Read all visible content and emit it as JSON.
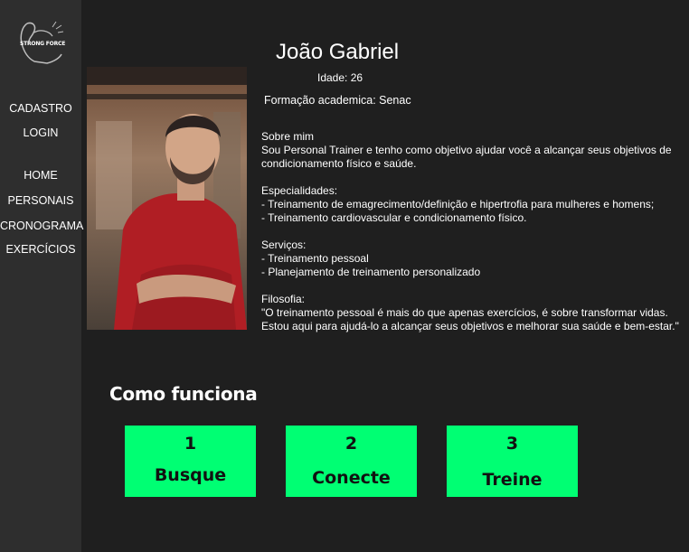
{
  "brand": {
    "logo_text": "STRONG FORCE"
  },
  "sidebar": {
    "auth": [
      {
        "label": "CADASTRO"
      },
      {
        "label": "LOGIN"
      }
    ],
    "nav": [
      {
        "label": "HOME"
      },
      {
        "label": "PERSONAIS"
      },
      {
        "label": "CRONOGRAMA"
      },
      {
        "label": "EXERCÍCIOS"
      }
    ]
  },
  "profile": {
    "name": "João Gabriel",
    "age": "Idade: 26",
    "formacao": "Formação academica: Senac",
    "sections": [
      {
        "text": "Sobre mim\nSou Personal Trainer e tenho como objetivo ajudar você a alcançar seus objetivos de condicionamento físico e saúde."
      },
      {
        "text": "Especialidades:\n- Treinamento de emagrecimento/definição e hipertrofia para mulheres e homens;\n- Treinamento cardiovascular e condicionamento físico."
      },
      {
        "text": "Serviços:\n- Treinamento pessoal\n- Planejamento de treinamento personalizado"
      },
      {
        "text": "Filosofia:\n\"O treinamento pessoal é mais do que apenas exercícios, é sobre transformar vidas. Estou aqui para ajudá-lo a alcançar seus objetivos e melhorar sua saúde e bem-estar.\""
      }
    ]
  },
  "how_it_works": {
    "title": "Como funciona",
    "steps": [
      {
        "num": "1",
        "label": "Busque"
      },
      {
        "num": "2",
        "label": "Conecte"
      },
      {
        "num": "3",
        "label": "Treine"
      }
    ]
  },
  "colors": {
    "background": "#1f1f1f",
    "sidebar": "#2e2e2e",
    "accent": "#00ff73"
  }
}
